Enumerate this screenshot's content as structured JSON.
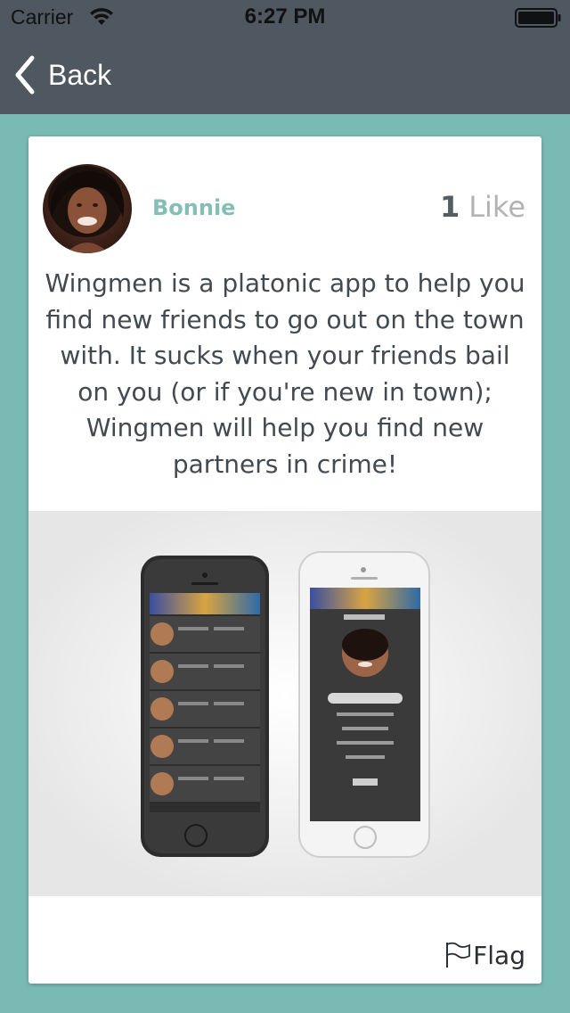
{
  "status_bar": {
    "carrier": "Carrier",
    "time": "6:27 PM",
    "wifi_icon": "wifi-icon",
    "battery_icon": "battery-icon"
  },
  "nav": {
    "back_label": "Back",
    "back_icon": "chevron-left-icon"
  },
  "post": {
    "author": "Bonnie",
    "like_count": "1",
    "like_label": "Like",
    "description": "Wingmen is a platonic app to help you find new friends to go out on the town with. It sucks when your friends bail on you (or if you're new in town); Wingmen will help you find new partners in crime!",
    "flag_label": "Flag",
    "flag_icon": "flag-icon"
  },
  "colors": {
    "background": "#79bab4",
    "nav_bar": "#4f5860",
    "author_name": "#85bdb8",
    "like_label": "#b3b3b3"
  }
}
